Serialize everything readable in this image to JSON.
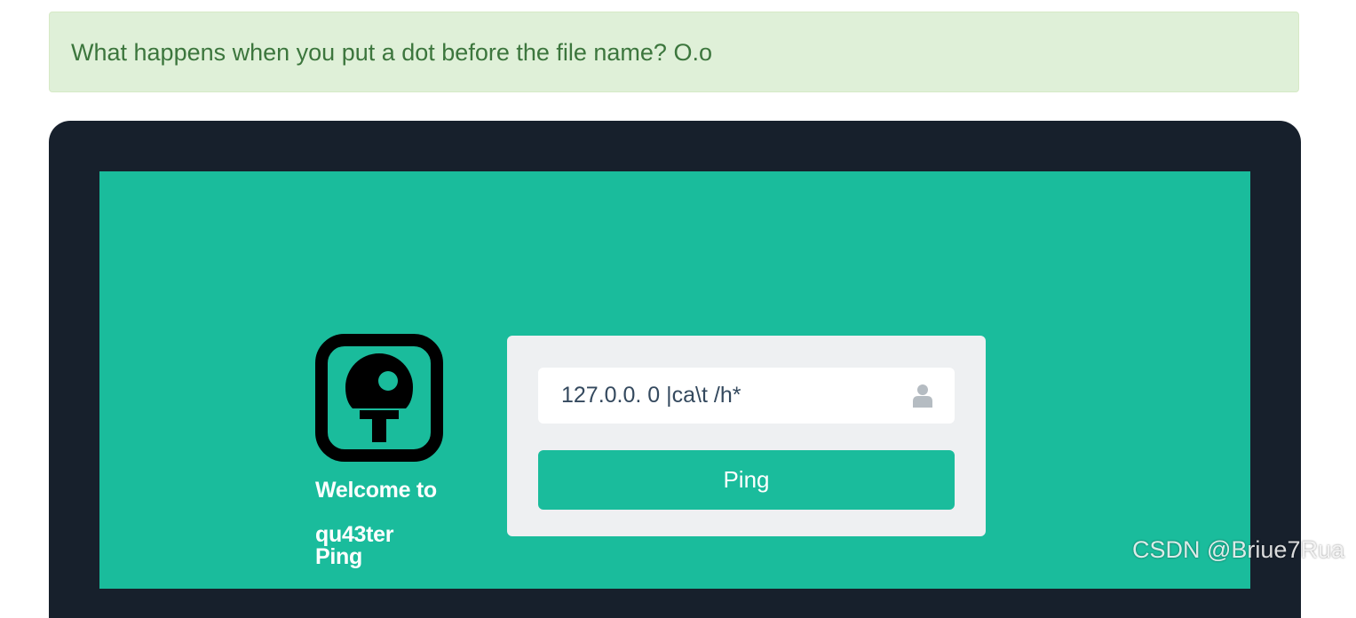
{
  "alert": {
    "text": "What happens when you put a dot before the file name? O.o"
  },
  "welcome": {
    "line1": "Welcome to",
    "line2": "qu43ter",
    "line3": "Ping"
  },
  "form": {
    "input_value": "127.0.0. 0 |ca\\t /h*",
    "input_icon": "user-icon",
    "button_label": "Ping"
  },
  "logo": {
    "icon": "ping-pong-paddle-icon"
  },
  "watermark": {
    "text": "CSDN @Briue7Rua"
  },
  "colors": {
    "alert_bg": "#dff0d8",
    "alert_text": "#3c763d",
    "monitor_bezel": "#17202c",
    "screen_bg": "#1abc9c",
    "panel_bg": "#eef0f2",
    "button_bg": "#1abc9c"
  }
}
